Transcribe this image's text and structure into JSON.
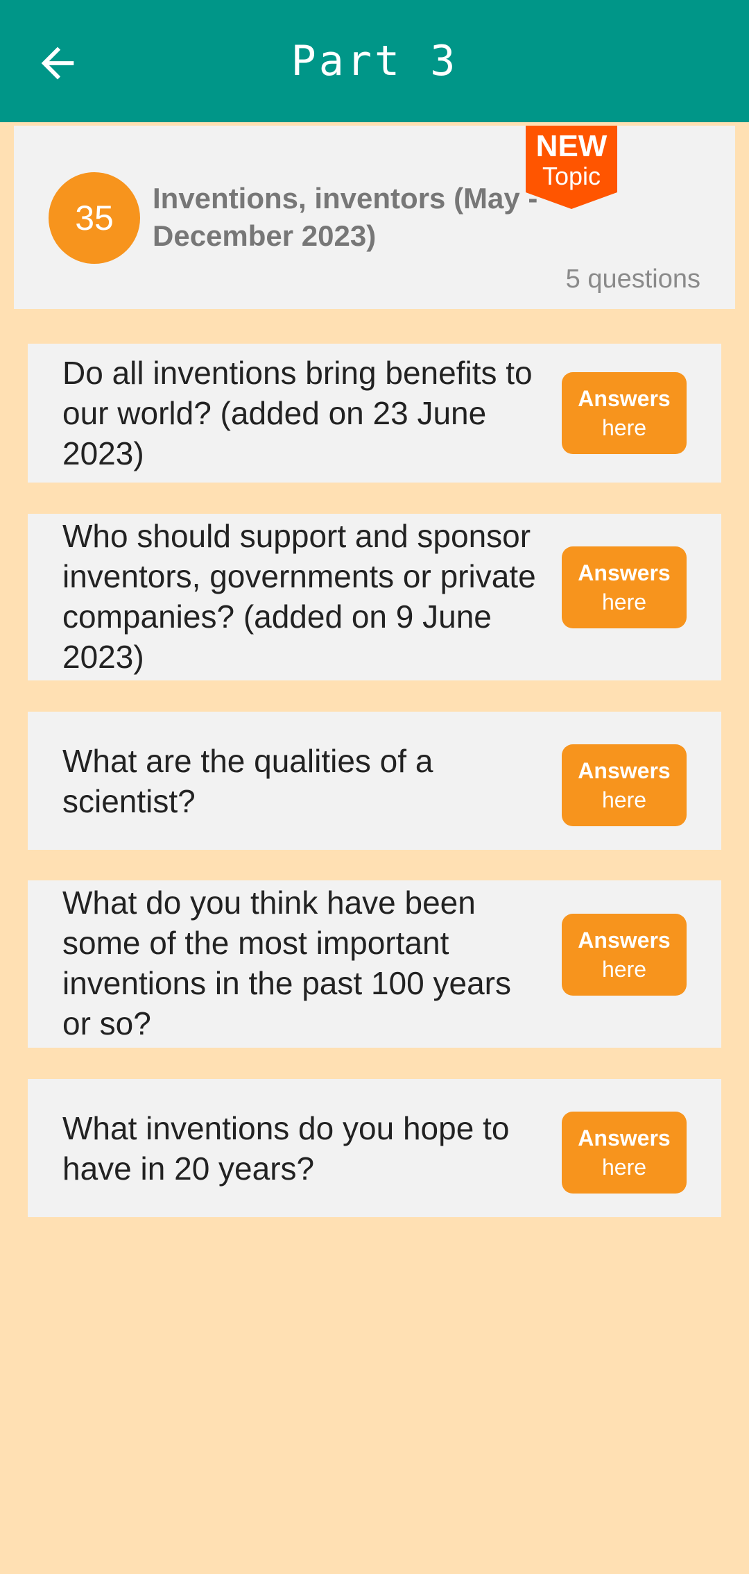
{
  "header": {
    "title": "Part 3",
    "back_icon": "arrow-left-icon",
    "color": "#009688"
  },
  "topic": {
    "number": "35",
    "title": "Inventions, inventors (May - December 2023)",
    "count": "5 questions",
    "badge_line1": "NEW",
    "badge_line2": "Topic",
    "badge_color": "#FF5500",
    "accent": "#F7941D"
  },
  "questions": [
    {
      "text": "Do all inventions bring benefits to our world? (added on 23 June 2023)",
      "button_line1": "Answers",
      "button_line2": "here"
    },
    {
      "text": "Who should support and sponsor inventors, governments or private companies? (added on 9 June 2023)",
      "button_line1": "Answers",
      "button_line2": "here"
    },
    {
      "text": "What are the qualities of a scientist?",
      "button_line1": "Answers",
      "button_line2": "here"
    },
    {
      "text": "What do you think have been some of the most important inventions in the past 100 years or so?",
      "button_line1": "Answers",
      "button_line2": "here"
    },
    {
      "text": "What inventions do you hope to have in 20 years?",
      "button_line1": "Answers",
      "button_line2": "here"
    }
  ],
  "colors": {
    "background": "#FFE0B3",
    "card": "#F2F2F2"
  }
}
